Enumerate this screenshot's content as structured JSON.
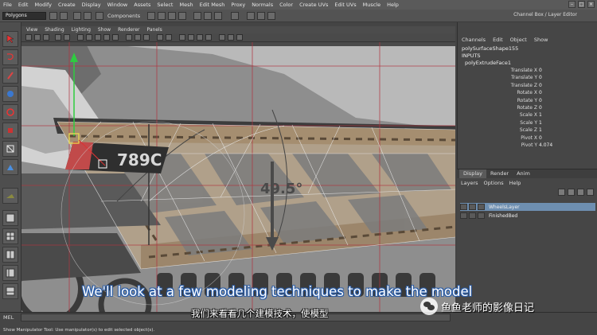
{
  "menubar": {
    "items": [
      "File",
      "Edit",
      "Modify",
      "Create",
      "Display",
      "Window",
      "Assets",
      "Select",
      "Mesh",
      "Edit Mesh",
      "Proxy",
      "Normals",
      "Color",
      "Create UVs",
      "Edit UVs",
      "Muscle",
      "Help"
    ]
  },
  "statusline": {
    "mode": "Polygons",
    "components_label": "Components",
    "channel_box_title": "Channel Box / Layer Editor"
  },
  "panel": {
    "menus": [
      "View",
      "Shading",
      "Lighting",
      "Show",
      "Renderer",
      "Panels"
    ]
  },
  "viewport": {
    "decal_text": "789C",
    "angle_label": "49.5°"
  },
  "channel_box": {
    "tabs": [
      "Channels",
      "Edit",
      "Object",
      "Show"
    ],
    "shape_name": "polySurfaceShape155",
    "inputs_label": "INPUTS",
    "node_name": "polyExtrudeFace1",
    "attributes": [
      {
        "name": "Translate X",
        "value": "0"
      },
      {
        "name": "Translate Y",
        "value": "0"
      },
      {
        "name": "Translate Z",
        "value": "0"
      },
      {
        "name": "Rotate X",
        "value": "0"
      },
      {
        "name": "Rotate Y",
        "value": "0"
      },
      {
        "name": "Rotate Z",
        "value": "0"
      },
      {
        "name": "Scale X",
        "value": "1"
      },
      {
        "name": "Scale Y",
        "value": "1"
      },
      {
        "name": "Scale Z",
        "value": "1"
      },
      {
        "name": "Pivot X",
        "value": "0"
      },
      {
        "name": "Pivot Y",
        "value": "4.074"
      }
    ]
  },
  "layer_editor": {
    "tabs": [
      "Display",
      "Render",
      "Anim"
    ],
    "menus": [
      "Layers",
      "Options",
      "Help"
    ],
    "layers": [
      {
        "name": "WheelsLayer",
        "selected": true
      },
      {
        "name": "FinishedBed",
        "selected": false
      }
    ]
  },
  "helpline": {
    "mel_label": "MEL",
    "help_text": "Show Manipulator Tool: Use manipulator(s) to edit selected object(s)."
  },
  "overlay": {
    "subtitle_en": "We'll look at a few modeling techniques to make the model",
    "subtitle_zh": "我们来看看几个建模技术，使模型",
    "watermark": "鱼鱼老师的影像日记"
  },
  "colors": {
    "viewport_bg": "#8c8c8c",
    "plank": "#a89478",
    "grid_red": "#b0343f",
    "selection_blue": "#6e8fb1",
    "subtitle_outline": "#2a5da8"
  }
}
